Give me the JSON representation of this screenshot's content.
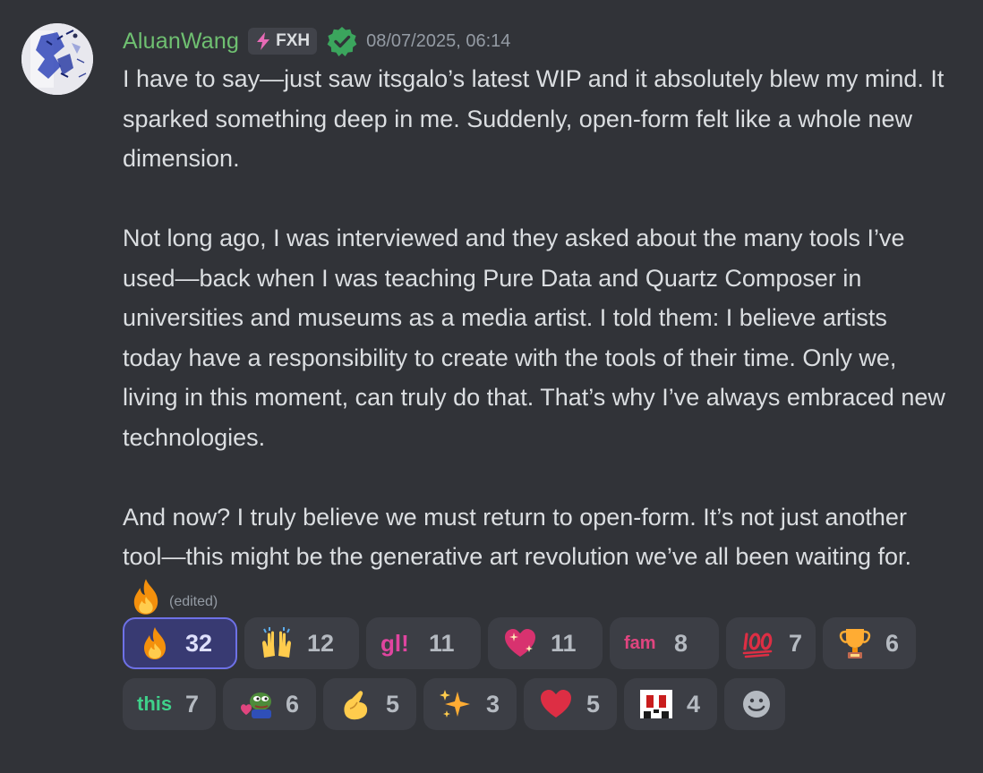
{
  "message": {
    "author": "AluanWang",
    "tag": "FXH",
    "timestamp": "08/07/2025, 06:14",
    "paragraphs": [
      "I have to say—just saw itsgalo’s latest WIP and it absolutely blew my mind. It sparked something deep in me. Suddenly, open-form felt like a whole new dimension.",
      "Not long ago, I was interviewed and they asked about the many tools I’ve used—back when I was teaching Pure Data and Quartz Composer in universities and museums as a media artist. I told them: I believe artists today have a responsibility to create with the tools of their time. Only we, living in this moment, can truly do that. That’s why I’ve always embraced new technologies.",
      "And now? I truly believe we must return to open-form. It’s not just another tool—this might be the generative art revolution we’ve all been waiting for."
    ],
    "edited_label": "(edited)"
  },
  "colors": {
    "background": "#313338",
    "username": "#6fc071",
    "text": "#dbdee1",
    "muted": "#949ba4",
    "reaction_bg": "#3c3e45",
    "reaction_active_bg": "#383a72",
    "reaction_active_border": "#6e71e6"
  },
  "reactions": {
    "row1": [
      {
        "emoji": "fire-emoji",
        "count": "32",
        "active": true
      },
      {
        "emoji": "raising-hands-emoji",
        "count": "12",
        "active": false
      },
      {
        "emoji": "gl-emoji",
        "text": "gl!",
        "count": "11",
        "active": false
      },
      {
        "emoji": "sparkling-heart-emoji",
        "count": "11",
        "active": false
      },
      {
        "emoji": "fam-emoji",
        "text": "fam",
        "count": "8",
        "active": false
      },
      {
        "emoji": "hundred-points-emoji",
        "count": "7",
        "active": false
      },
      {
        "emoji": "trophy-emoji",
        "count": "6",
        "active": false
      }
    ],
    "row2": [
      {
        "emoji": "this-emoji",
        "text": "this",
        "count": "7",
        "active": false
      },
      {
        "emoji": "pepe-emoji",
        "count": "6",
        "active": false
      },
      {
        "emoji": "pinching-hand-emoji",
        "count": "5",
        "active": false
      },
      {
        "emoji": "sparkles-emoji",
        "count": "3",
        "active": false
      },
      {
        "emoji": "red-heart-emoji",
        "count": "5",
        "active": false
      },
      {
        "emoji": "pixel-face-emoji",
        "count": "4",
        "active": false
      }
    ],
    "add_reaction_icon": "smiley-add-reaction-icon"
  }
}
